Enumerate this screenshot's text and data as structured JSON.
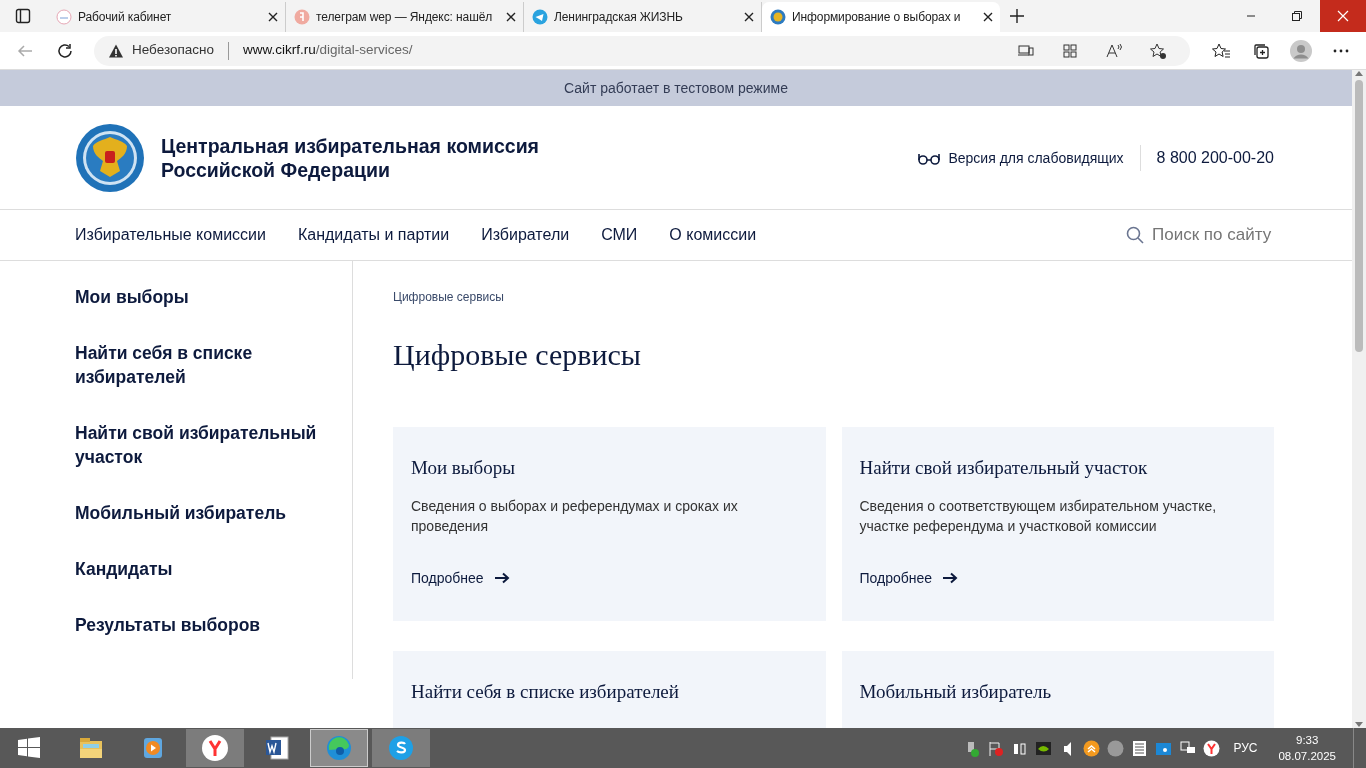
{
  "browser": {
    "tabs": [
      {
        "title": "Рабочий кабинет",
        "kind": "cabinet",
        "selected": false
      },
      {
        "title": "телеграм wep — Яндекс: нашёл",
        "kind": "yandex",
        "selected": false
      },
      {
        "title": "Ленинградская ЖИЗНЬ",
        "kind": "telegram",
        "selected": false
      },
      {
        "title": "Информирование о выборах и",
        "kind": "emblem",
        "selected": true
      }
    ],
    "security": "Небезопасно",
    "url_host": "www.cikrf.ru",
    "url_path": "/digital-services/"
  },
  "page": {
    "banner": "Сайт работает в тестовом режиме",
    "header": {
      "title_lines": [
        "Центральная избирательная комиссия",
        "Российской Федерации"
      ],
      "vision_link": "Версия для слабовидящих",
      "phone": "8 800 200-00-20"
    },
    "nav": [
      "Избирательные комиссии",
      "Кандидаты и партии",
      "Избиратели",
      "СМИ",
      "О комиссии"
    ],
    "search": {
      "placeholder": "Поиск по сайту"
    },
    "sidebar": [
      "Мои выборы",
      "Найти себя в списке избирателей",
      "Найти свой избирательный участок",
      "Мобильный избиратель",
      "Кандидаты",
      "Результаты выборов"
    ],
    "breadcrumb": "Цифровые сервисы",
    "heading": "Цифровые сервисы",
    "cards": [
      {
        "title": "Мои выборы",
        "description": "Сведения о выборах и референдумах и сроках их проведения",
        "link": "Подробнее"
      },
      {
        "title": "Найти свой избирательный участок",
        "description": "Сведения о соответствующем избирательном участке, участке референдума и участковой комиссии",
        "link": "Подробнее"
      },
      {
        "title": "Найти себя в списке избирателей"
      },
      {
        "title": "Мобильный избиратель"
      }
    ]
  },
  "taskbar": {
    "apps": [
      {
        "kind": "start",
        "running": false,
        "selected": false
      },
      {
        "kind": "explorer",
        "running": false,
        "selected": false
      },
      {
        "kind": "media",
        "running": false,
        "selected": false
      },
      {
        "kind": "yandex",
        "running": true,
        "selected": false
      },
      {
        "kind": "word",
        "running": false,
        "selected": false
      },
      {
        "kind": "edge",
        "running": true,
        "selected": true
      },
      {
        "kind": "skype",
        "running": true,
        "selected": false
      }
    ],
    "language": "РУС",
    "time": "9:33",
    "date": "08.07.2025"
  }
}
